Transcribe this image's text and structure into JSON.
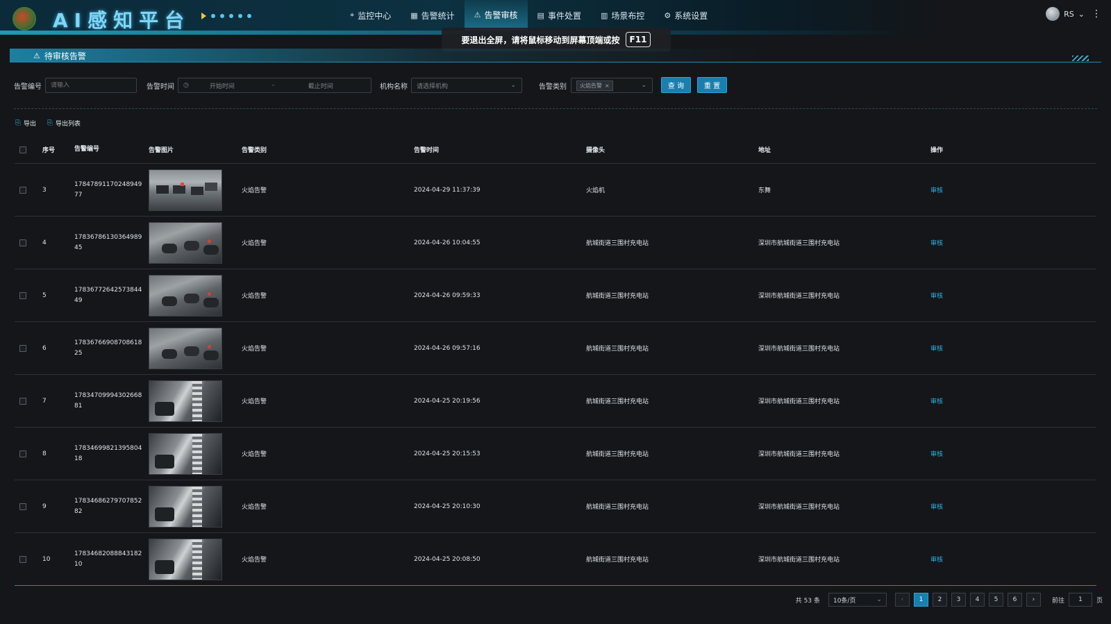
{
  "header": {
    "app_title": "AI感知平台",
    "nav": [
      {
        "icon": "target-icon",
        "glyph": "⌖",
        "label": "监控中心"
      },
      {
        "icon": "chart-icon",
        "glyph": "▦",
        "label": "告警统计"
      },
      {
        "icon": "alert-icon",
        "glyph": "⚠",
        "label": "告警审核"
      },
      {
        "icon": "calendar-icon",
        "glyph": "▤",
        "label": "事件处置"
      },
      {
        "icon": "layout-icon",
        "glyph": "▥",
        "label": "场景布控"
      },
      {
        "icon": "gear-icon",
        "glyph": "⚙",
        "label": "系统设置"
      }
    ],
    "active_nav_index": 2,
    "user_name": "RS"
  },
  "fullscreen_hint": {
    "text": "要退出全屏，请将鼠标移动到屏幕顶端或按",
    "key": "F11"
  },
  "section_title": "待审核告警",
  "filters": {
    "code_label": "告警编号",
    "code_placeholder": "请输入",
    "time_label": "告警时间",
    "start_placeholder": "开始时间",
    "range_sep": "-",
    "end_placeholder": "截止时间",
    "org_label": "机构名称",
    "org_placeholder": "请选择机构",
    "type_label": "告警类别",
    "type_tag": "火焰告警",
    "query_button": "查 询",
    "reset_button": "重 置"
  },
  "export": {
    "export_label": "导出",
    "export_list_label": "导出列表"
  },
  "table": {
    "columns": [
      "序号",
      "告警编号",
      "告警图片",
      "告警类别",
      "告警时间",
      "摄像头",
      "地址",
      "操作"
    ],
    "rows": [
      {
        "idx": "3",
        "code1": "17847891170248949",
        "code2": "77",
        "img": "office",
        "type": "火焰告警",
        "time": "2024-04-29 11:37:39",
        "camera": "火焰机",
        "address": "东舞",
        "action": "审核"
      },
      {
        "idx": "4",
        "code1": "17836786130364989",
        "code2": "45",
        "img": "garage",
        "type": "火焰告警",
        "time": "2024-04-26 10:04:55",
        "camera": "航城街道三围村充电站",
        "address": "深圳市航城街道三围村充电站",
        "action": "审核"
      },
      {
        "idx": "5",
        "code1": "17836772642573844",
        "code2": "49",
        "img": "garage",
        "type": "火焰告警",
        "time": "2024-04-26 09:59:33",
        "camera": "航城街道三围村充电站",
        "address": "深圳市航城街道三围村充电站",
        "action": "审核"
      },
      {
        "idx": "6",
        "code1": "17836766908708618",
        "code2": "25",
        "img": "garage",
        "type": "火焰告警",
        "time": "2024-04-26 09:57:16",
        "camera": "航城街道三围村充电站",
        "address": "深圳市航城街道三围村充电站",
        "action": "审核"
      },
      {
        "idx": "7",
        "code1": "17834709994302668",
        "code2": "81",
        "img": "night",
        "type": "火焰告警",
        "time": "2024-04-25 20:19:56",
        "camera": "航城街道三围村充电站",
        "address": "深圳市航城街道三围村充电站",
        "action": "审核"
      },
      {
        "idx": "8",
        "code1": "17834699821395804",
        "code2": "18",
        "img": "night",
        "type": "火焰告警",
        "time": "2024-04-25 20:15:53",
        "camera": "航城街道三围村充电站",
        "address": "深圳市航城街道三围村充电站",
        "action": "审核"
      },
      {
        "idx": "9",
        "code1": "17834686279707852",
        "code2": "82",
        "img": "night",
        "type": "火焰告警",
        "time": "2024-04-25 20:10:30",
        "camera": "航城街道三围村充电站",
        "address": "深圳市航城街道三围村充电站",
        "action": "审核"
      },
      {
        "idx": "10",
        "code1": "17834682088843182",
        "code2": "10",
        "img": "night",
        "type": "火焰告警",
        "time": "2024-04-25 20:08:50",
        "camera": "航城街道三围村充电站",
        "address": "深圳市航城街道三围村充电站",
        "action": "审核"
      }
    ]
  },
  "pagination": {
    "total_text": "共 53 条",
    "page_size": "10条/页",
    "pages": [
      "1",
      "2",
      "3",
      "4",
      "5",
      "6"
    ],
    "current_page": "1",
    "goto_label": "前往",
    "goto_value": "1",
    "page_unit": "页"
  },
  "colors": {
    "accent": "#1a7fae",
    "link": "#2db3e6",
    "background": "#141619"
  }
}
